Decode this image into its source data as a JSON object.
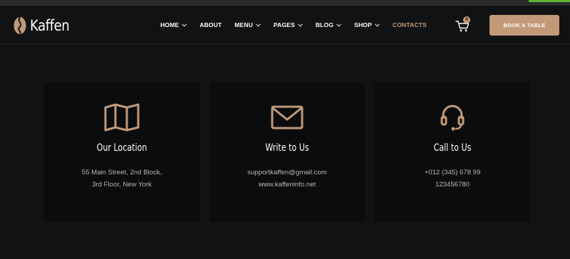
{
  "brand": {
    "name": "Kaffen"
  },
  "nav": {
    "items": [
      {
        "label": "HOME",
        "has_dropdown": true,
        "active": false
      },
      {
        "label": "ABOUT",
        "has_dropdown": false,
        "active": false
      },
      {
        "label": "MENU",
        "has_dropdown": true,
        "active": false
      },
      {
        "label": "PAGES",
        "has_dropdown": true,
        "active": false
      },
      {
        "label": "BLOG",
        "has_dropdown": true,
        "active": false
      },
      {
        "label": "SHOP",
        "has_dropdown": true,
        "active": false
      },
      {
        "label": "CONTACTS",
        "has_dropdown": false,
        "active": true
      }
    ]
  },
  "cart": {
    "icon": "cart-icon",
    "count": "0"
  },
  "header_button": {
    "label": "BOOK A TABLE"
  },
  "cards": [
    {
      "icon": "map-icon",
      "title": "Our Location",
      "line1": "55 Main Street, 2nd Block,",
      "line2": "3rd Floor, New York"
    },
    {
      "icon": "mail-icon",
      "title": "Write to Us",
      "line1": "supportkaffen@gmail.com",
      "line2": "www.kaffeninfo.net"
    },
    {
      "icon": "headset-icon",
      "title": "Call to Us",
      "line1": "+012 (345) 678 99",
      "line2": "123456780"
    }
  ],
  "colors": {
    "accent": "#c29a78",
    "background": "#111214",
    "card": "#0b0c0e"
  }
}
